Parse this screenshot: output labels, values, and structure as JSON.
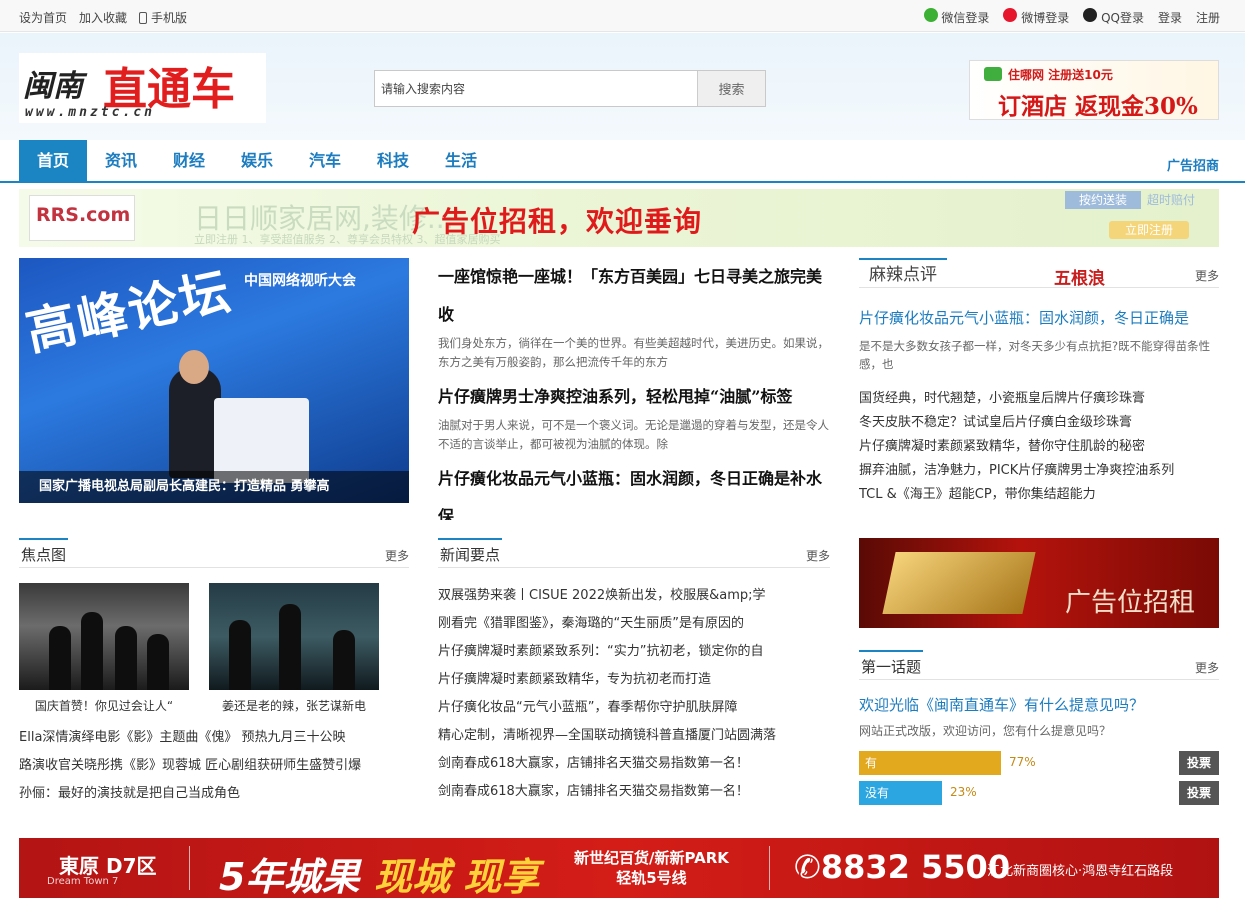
{
  "topbar": {
    "left": [
      "设为首页",
      "加入收藏",
      "手机版"
    ],
    "wechat": "微信登录",
    "weibo": "微博登录",
    "qq": "QQ登录",
    "login": "登录",
    "register": "注册"
  },
  "logo": {
    "part1": "闽南",
    "part2": "直通车",
    "url_text": "www.mnztc.cn"
  },
  "search": {
    "placeholder": "请输入搜索内容",
    "value": "请输入搜索内容",
    "button": "搜索"
  },
  "header_ad": {
    "brand": "住哪网 注册送10元",
    "main": "订酒店 返现金30%"
  },
  "nav": {
    "items": [
      "首页",
      "资讯",
      "财经",
      "娱乐",
      "汽车",
      "科技",
      "生活"
    ],
    "active": "首页",
    "ad_link": "广告招商"
  },
  "wide_ad": {
    "logo": "RRS.com",
    "faint_title": "日日顺家居网,装修...",
    "faint_sub": "立即注册  1、享受超值服务   2、尊享会员特权   3、超值家居购买",
    "headline": "广告位招租，欢迎垂询",
    "tag": "按约送装",
    "tag2": "超时赔付",
    "register": "立即注册"
  },
  "hero": {
    "big_text": "高峰论坛",
    "sub": "中国网络视听大会",
    "caption": "国家广播电视总局副局长高建民：打造精品 勇攀高"
  },
  "headlines": [
    {
      "title": "一座馆惊艳一座城！「东方百美园」七日寻美之旅完美收",
      "desc": "我们身处东方，徜徉在一个美的世界。有些美超越时代，美进历史。如果说，东方之美有万般姿韵，那么把流传千年的东方"
    },
    {
      "title": "片仔癀牌男士净爽控油系列，轻松甩掉“油腻”标签",
      "desc": "油腻对于男人来说，可不是一个褒义词。无论是邋遢的穿着与发型，还是令人不适的言谈举止，都可被视为油腻的体现。除"
    },
    {
      "title": "片仔癀化妆品元气小蓝瓶：固水润颜，冬日正确是补水保",
      "desc": ""
    }
  ],
  "mala": {
    "title": "麻辣点评",
    "brand": "五根浪",
    "more": "更多",
    "top_title": "片仔癀化妆品元气小蓝瓶：固水润颜，冬日正确是",
    "top_desc": "是不是大多数女孩子都一样，对冬天多少有点抗拒?既不能穿得苗条性感，也",
    "items": [
      "国货经典，时代翘楚，小瓷瓶皇后牌片仔癀珍珠膏",
      "冬天皮肤不稳定？试试皇后片仔癀白金级珍珠膏",
      "片仔癀牌凝时素颜紧致精华，替你守住肌龄的秘密",
      "摒弃油腻，洁净魅力，PICK片仔癀牌男士净爽控油系列",
      "TCL &《海王》超能CP，带你集结超能力"
    ]
  },
  "right_ad": {
    "text": "广告位招租"
  },
  "focus": {
    "title": "焦点图",
    "more": "更多",
    "thumbs": [
      "国庆首赞！你见过会让人“",
      "姜还是老的辣，张艺谋新电"
    ],
    "items": [
      "Ella深情演绎电影《影》主题曲《傀》 预热九月三十公映",
      "路演收官关晓彤携《影》现蓉城 匠心剧组获研师生盛赞引爆",
      "孙俪：最好的演技就是把自己当成角色"
    ]
  },
  "news": {
    "title": "新闻要点",
    "more": "更多",
    "items": [
      "双展强势来袭丨CISUE 2022焕新出发，校服展&amp;学",
      "刚看完《猎罪图鉴》，秦海璐的“天生丽质”是有原因的",
      "片仔癀牌凝时素颜紧致系列：“实力”抗初老，锁定你的自",
      "片仔癀牌凝时素颜紧致精华，专为抗初老而打造",
      "片仔癀化妆品“元气小蓝瓶”，春季帮你守护肌肤屏障",
      "精心定制，清晰视界—全国联动摘镜科普直播厦门站圆满落",
      "剑南春成618大赢家，店铺排名天猫交易指数第一名！",
      "剑南春成618大赢家，店铺排名天猫交易指数第一名！"
    ]
  },
  "topic": {
    "title": "第一话题",
    "more": "更多",
    "question": "欢迎光临《闽南直通车》有什么提意见吗？",
    "desc": "网站正式改版，欢迎访问，您有什么提意见吗？",
    "options": [
      {
        "label": "有",
        "percent": 77,
        "percent_text": "77%",
        "color": "#e2a81e",
        "button": "投票"
      },
      {
        "label": "没有",
        "percent": 23,
        "percent_text": "23%",
        "color": "#2ba6e0",
        "button": "投票"
      }
    ]
  },
  "bottom_ad": {
    "brand": "東原 D7区",
    "brand_sub": "Dream Town 7",
    "slogan1": "5年城果",
    "slogan2": "现城 现享",
    "mall_line1": "新世纪百货/新新PARK",
    "mall_line2": "轻轨5号线",
    "tel": "✆8832 5500",
    "addr": "江北新商圈核心·鸿恩寺红石路段"
  }
}
